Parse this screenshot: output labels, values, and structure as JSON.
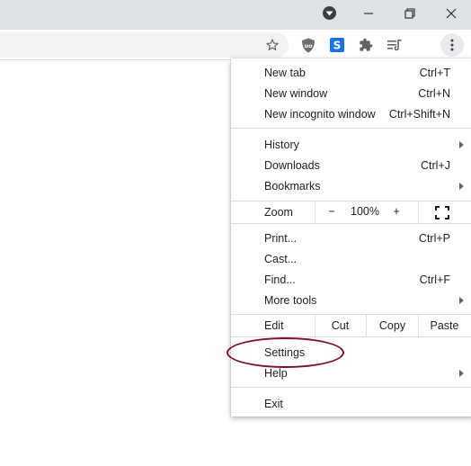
{
  "titlebar": {
    "tab_search_icon": "tab-search-icon",
    "minimize_icon": "minimize-icon",
    "restore_icon": "restore-icon",
    "close_icon": "close-icon"
  },
  "toolbar": {
    "bookmark_icon": "star-icon",
    "extensions": [
      "ublock-origin-icon",
      "s-extension-icon",
      "extensions-puzzle-icon",
      "media-queue-icon"
    ],
    "menu_icon": "three-dots-vertical-icon",
    "s_extension_letter": "S"
  },
  "menu": {
    "group1": [
      {
        "label": "New tab",
        "shortcut": "Ctrl+T"
      },
      {
        "label": "New window",
        "shortcut": "Ctrl+N"
      },
      {
        "label": "New incognito window",
        "shortcut": "Ctrl+Shift+N"
      }
    ],
    "group2": [
      {
        "label": "History",
        "shortcut": ""
      },
      {
        "label": "Downloads",
        "shortcut": "Ctrl+J"
      },
      {
        "label": "Bookmarks",
        "shortcut": ""
      }
    ],
    "zoom": {
      "label": "Zoom",
      "minus": "−",
      "value": "100%",
      "plus": "+"
    },
    "group3": [
      {
        "label": "Print...",
        "shortcut": "Ctrl+P"
      },
      {
        "label": "Cast...",
        "shortcut": ""
      },
      {
        "label": "Find...",
        "shortcut": "Ctrl+F"
      },
      {
        "label": "More tools",
        "shortcut": ""
      }
    ],
    "edit": {
      "label": "Edit",
      "cut": "Cut",
      "copy": "Copy",
      "paste": "Paste"
    },
    "group4": [
      {
        "label": "Settings"
      },
      {
        "label": "Help"
      }
    ],
    "exit": {
      "label": "Exit"
    }
  },
  "colors": {
    "titlebar_bg": "#dee1e6",
    "annotation": "#7b1228",
    "s_extension": "#1a73e8"
  }
}
